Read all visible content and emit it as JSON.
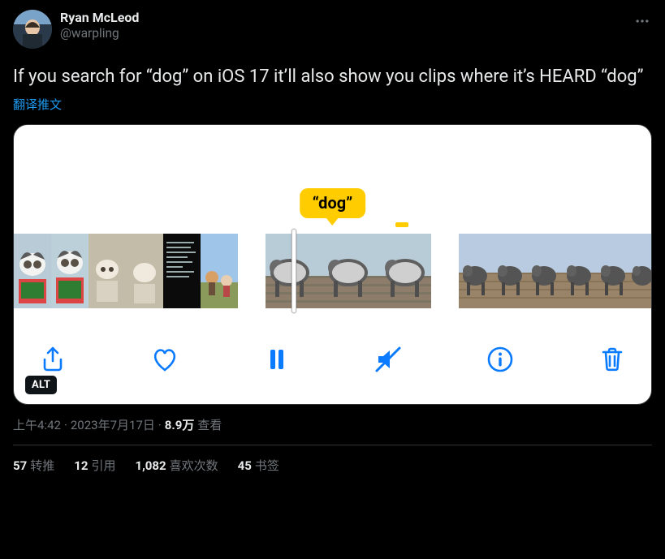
{
  "user": {
    "displayName": "Ryan McLeod",
    "handle": "@warpling"
  },
  "tweet": {
    "text": "If you search for “dog” on iOS 17 it’ll also show you clips where it’s HEARD “dog”",
    "translateLabel": "翻译推文"
  },
  "media": {
    "captionBubble": "“dog”",
    "altBadge": "ALT"
  },
  "meta": {
    "time": "上午4:42",
    "date": "2023年7月17日",
    "viewsValue": "8.9万",
    "viewsLabel": "查看"
  },
  "stats": {
    "retweets": {
      "value": "57",
      "label": "转推"
    },
    "quotes": {
      "value": "12",
      "label": "引用"
    },
    "likes": {
      "value": "1,082",
      "label": "喜欢次数"
    },
    "bookmarks": {
      "value": "45",
      "label": "书签"
    }
  },
  "icons": {
    "more": "more-icon",
    "share": "share-icon",
    "heart": "heart-icon",
    "pause": "pause-icon",
    "mute": "mute-icon",
    "info": "info-icon",
    "trash": "trash-icon"
  }
}
